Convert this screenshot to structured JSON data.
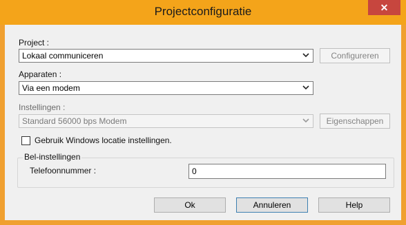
{
  "window": {
    "title": "Projectconfiguratie",
    "close_icon": "close-icon"
  },
  "project": {
    "label": "Project :",
    "value": "Lokaal communiceren",
    "configure_button": "Configureren"
  },
  "devices": {
    "label": "Apparaten :",
    "value": "Via een modem"
  },
  "settings": {
    "label": "Instellingen :",
    "value": "Standard 56000 bps Modem",
    "properties_button": "Eigenschappen"
  },
  "windows_location": {
    "label": "Gebruik Windows locatie instellingen.",
    "checked": false
  },
  "dial_settings": {
    "group_label": "Bel-instellingen",
    "phone_label": "Telefoonnummer :",
    "phone_value": "0"
  },
  "footer": {
    "ok_button": "Ok",
    "cancel_button": "Annuleren",
    "help_button": "Help"
  }
}
